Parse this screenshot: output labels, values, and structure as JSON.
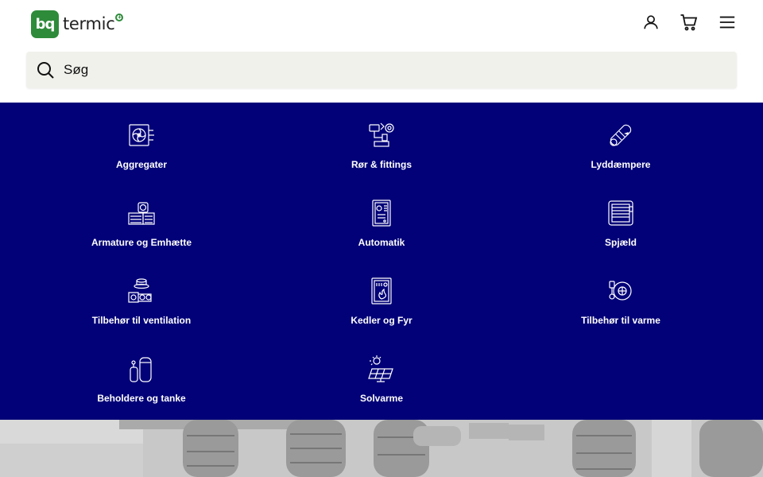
{
  "brand": {
    "badge": "bq",
    "name": "termic",
    "color": "#2e8b3a"
  },
  "header": {
    "icons": [
      "user-icon",
      "cart-icon",
      "menu-icon"
    ]
  },
  "search": {
    "placeholder": "Søg"
  },
  "menu": {
    "background": "#020178",
    "categories": [
      {
        "label": "Aggregater",
        "icon": "air-handling-unit-icon"
      },
      {
        "label": "Rør & fittings",
        "icon": "pipes-fittings-icon"
      },
      {
        "label": "Lyddæmpere",
        "icon": "silencer-icon"
      },
      {
        "label": "Armature og Emhætte",
        "icon": "valve-hood-icon"
      },
      {
        "label": "Automatik",
        "icon": "control-panel-icon"
      },
      {
        "label": "Spjæld",
        "icon": "damper-icon"
      },
      {
        "label": "Tilbehør til ventilation",
        "icon": "ventilation-accessory-icon"
      },
      {
        "label": "Kedler og Fyr",
        "icon": "boiler-icon"
      },
      {
        "label": "Tilbehør til varme",
        "icon": "heating-pump-icon"
      },
      {
        "label": "Beholdere og tanke",
        "icon": "tank-icon"
      },
      {
        "label": "Solvarme",
        "icon": "solar-panel-icon"
      }
    ]
  }
}
